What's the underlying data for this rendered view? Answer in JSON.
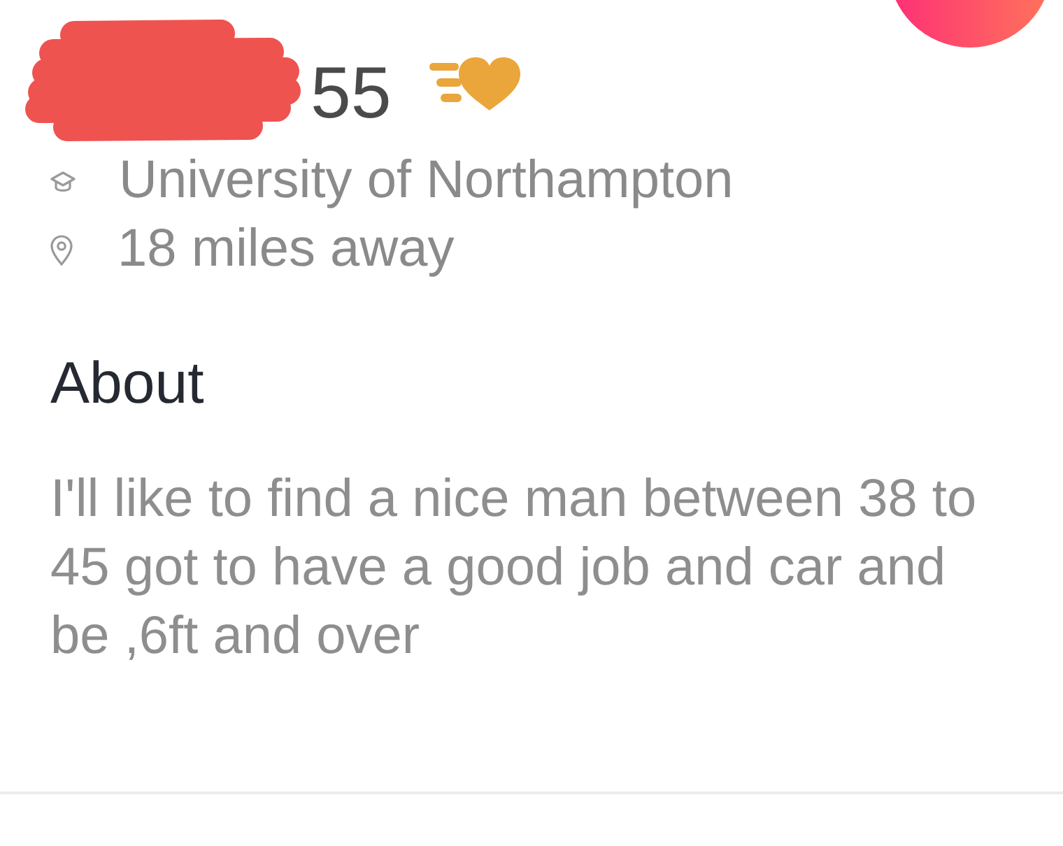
{
  "profile": {
    "name_redacted": true,
    "age": "55"
  },
  "details": [
    {
      "kind": "school",
      "text": "University of Northampton"
    },
    {
      "kind": "distance",
      "text": "18 miles away"
    }
  ],
  "about": {
    "heading": "About",
    "text": "I'll like to find a nice man between 38 to 45 got to have a good job and car and be ,6ft and over"
  }
}
